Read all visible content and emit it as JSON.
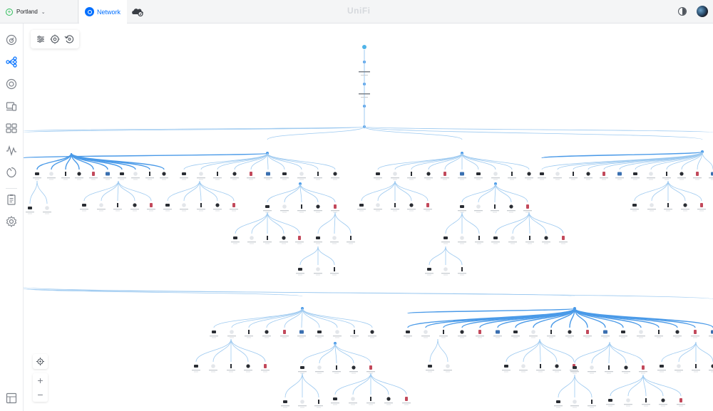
{
  "header": {
    "site_name": "Portland",
    "app_tab": "Network",
    "brand": "UniFi"
  },
  "icons": {
    "site": "site-status-icon",
    "dropdown": "chevron-down-icon",
    "app": "network-app-icon",
    "cloud_gateway": "cloud-gateway-icon",
    "theme": "theme-toggle-icon",
    "avatar": "user-avatar",
    "sidebar": [
      "dashboard-icon",
      "topology-icon",
      "devices-icon",
      "client-devices-icon",
      "ports-icon",
      "insights-icon",
      "security-icon",
      "system-log-icon",
      "settings-icon",
      "release-notes-icon"
    ],
    "toolbar": [
      "filter-icon",
      "focus-icon",
      "reset-view-icon"
    ],
    "zoom": [
      "recenter-icon",
      "zoom-in-icon",
      "zoom-out-icon"
    ]
  },
  "zoom": {
    "plus": "+",
    "minus": "−"
  },
  "colors": {
    "accent": "#006fff",
    "online": "#2ebd5a",
    "link": "#9cc9f0",
    "link_bold": "#4a9ae8",
    "device_dark": "#2a2d33",
    "device_light": "#e3e6ea"
  }
}
